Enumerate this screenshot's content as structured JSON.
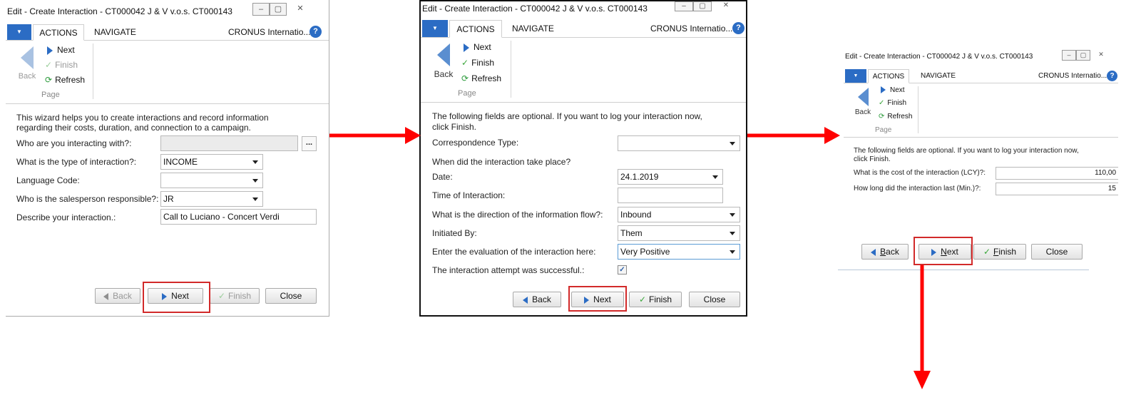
{
  "colors": {
    "accent": "#2b6cc4",
    "annotation_arrow": "#ff0000",
    "highlight_box": "#d22a2a"
  },
  "panel1": {
    "title": "Edit - Create Interaction - CT000042 J & V v.o.s. CT000143",
    "tabs": {
      "actions": "ACTIONS",
      "navigate": "NAVIGATE"
    },
    "company": "CRONUS Internatio...",
    "ribbon": {
      "back": "Back",
      "next": "Next",
      "finish": "Finish",
      "refresh": "Refresh",
      "group": "Page"
    },
    "intro": "This wizard helps you to create interactions and record information regarding their costs, duration, and connection to a campaign.",
    "fields": [
      {
        "label": "Who are you interacting with?:",
        "value": ""
      },
      {
        "label": "What is the type of interaction?:",
        "value": "INCOME"
      },
      {
        "label": "Language Code:",
        "value": ""
      },
      {
        "label": "Who is the salesperson responsible?:",
        "value": "JR"
      },
      {
        "label": "Describe your interaction.:",
        "value": "Call to Luciano - Concert Verdi"
      }
    ],
    "ellipsis": "...",
    "buttons": {
      "back": "Back",
      "next": "Next",
      "finish": "Finish",
      "close": "Close"
    }
  },
  "panel2": {
    "title": "Edit - Create Interaction - CT000042 J & V v.o.s. CT000143",
    "tabs": {
      "actions": "ACTIONS",
      "navigate": "NAVIGATE"
    },
    "company": "CRONUS Internatio...",
    "ribbon": {
      "back": "Back",
      "next": "Next",
      "finish": "Finish",
      "refresh": "Refresh",
      "group": "Page"
    },
    "intro": "The following fields are optional. If you want to log your interaction now, click Finish.",
    "correspondence_label": "Correspondence Type:",
    "correspondence_value": "",
    "when_heading": "When did the interaction take place?",
    "date_label": "Date:",
    "date_value": "24.1.2019",
    "time_label": "Time of Interaction:",
    "time_value": "",
    "direction_label": "What is the direction of the information flow?:",
    "direction_value": "Inbound",
    "initiated_label": "Initiated By:",
    "initiated_value": "Them",
    "evaluation_label": "Enter the evaluation of the interaction here:",
    "evaluation_value": "Very Positive",
    "success_label": "The interaction attempt was successful.:",
    "success_checked": true,
    "checkmark": "✓",
    "buttons": {
      "back": "Back",
      "next": "Next",
      "finish": "Finish",
      "close": "Close"
    }
  },
  "panel3": {
    "title": "Edit - Create Interaction - CT000042 J & V v.o.s. CT000143",
    "tabs": {
      "actions": "ACTIONS",
      "navigate": "NAVIGATE"
    },
    "company": "CRONUS Internatio...",
    "ribbon": {
      "back": "Back",
      "next": "Next",
      "finish": "Finish",
      "refresh": "Refresh",
      "group": "Page"
    },
    "intro": "The following fields are optional. If you want to log your interaction now, click Finish.",
    "cost_label": "What is the cost of the interaction (LCY)?:",
    "cost_value": "110,00",
    "duration_label": "How long did the interaction last (Min.)?:",
    "duration_value": "15",
    "buttons": {
      "back_u": "B",
      "back_rest": "ack",
      "next_u": "N",
      "next_rest": "ext",
      "finish_u": "F",
      "finish_rest": "inish",
      "close": "Close"
    }
  },
  "icons": {
    "check": "✓",
    "refresh": "⟳",
    "help": "?",
    "minimize": "–",
    "maximize": "▢",
    "close": "✕",
    "dropdown": "▼"
  }
}
